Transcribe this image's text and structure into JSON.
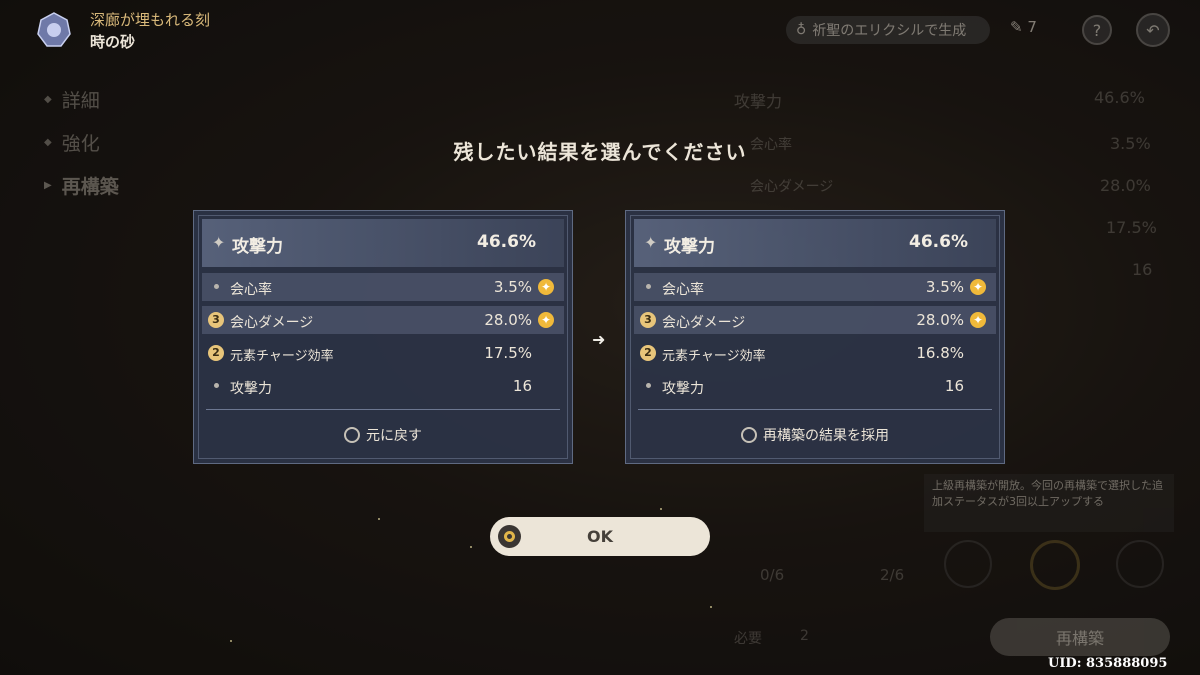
{
  "header": {
    "title": "深廊が埋もれる刻",
    "subtitle": "時の砂",
    "elixir_button": "祈聖のエリクシルで生成",
    "resource_count": "7",
    "help_icon": "?",
    "back_icon": "back-icon"
  },
  "nav": {
    "items": [
      "詳細",
      "強化",
      "再構築"
    ]
  },
  "dialog": {
    "title": "残したい結果を選んでください",
    "left_panel": {
      "main_stat": {
        "label": "攻撃力",
        "value": "46.6%"
      },
      "substats": [
        {
          "label": "会心率",
          "value": "3.5%",
          "marker": "bullet",
          "star": true,
          "highlight": true
        },
        {
          "label": "会心ダメージ",
          "value": "28.0%",
          "marker": "3",
          "star": true,
          "highlight": true
        },
        {
          "label": "元素チャージ効率",
          "value": "17.5%",
          "marker": "2",
          "star": false,
          "highlight": false
        },
        {
          "label": "攻撃力",
          "value": "16",
          "marker": "bullet",
          "star": false,
          "highlight": false
        }
      ],
      "option_label": "元に戻す"
    },
    "right_panel": {
      "main_stat": {
        "label": "攻撃力",
        "value": "46.6%"
      },
      "substats": [
        {
          "label": "会心率",
          "value": "3.5%",
          "marker": "bullet",
          "star": true,
          "highlight": true
        },
        {
          "label": "会心ダメージ",
          "value": "28.0%",
          "marker": "3",
          "star": true,
          "highlight": true
        },
        {
          "label": "元素チャージ効率",
          "value": "16.8%",
          "marker": "2",
          "star": false,
          "highlight": false
        },
        {
          "label": "攻撃力",
          "value": "16",
          "marker": "bullet",
          "star": false,
          "highlight": false
        }
      ],
      "option_label": "再構築の結果を採用"
    },
    "ok_label": "OK"
  },
  "background": {
    "main_stat": {
      "label": "攻撃力",
      "value": "46.6%"
    },
    "sub_values": [
      "3.5%",
      "28.0%",
      "17.5%",
      "16"
    ],
    "sub_labels": [
      "会心率",
      "会心ダメージ"
    ],
    "tooltip": "上級再構築が開放。今回の再構築で選択した追加ステータスが3回以上アップする",
    "progress_from": "0/6",
    "progress_to": "2/6",
    "required_label": "必要",
    "required_count": "2",
    "reconstruct_button": "再構築"
  },
  "uid": "UID: 835888095",
  "colors": {
    "accent_gold": "#e1b64a",
    "panel_bg": "#2c3447",
    "star_badge": "#f0b93a"
  }
}
